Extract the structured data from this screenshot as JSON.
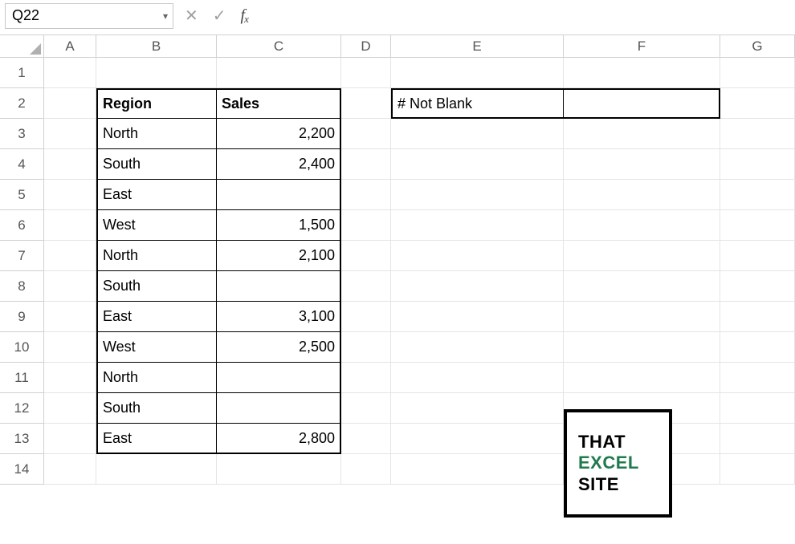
{
  "namebox": "Q22",
  "formula": "",
  "col_labels": [
    "A",
    "B",
    "C",
    "D",
    "E",
    "F",
    "G"
  ],
  "row_labels": [
    "1",
    "2",
    "3",
    "4",
    "5",
    "6",
    "7",
    "8",
    "9",
    "10",
    "11",
    "12",
    "13",
    "14"
  ],
  "table": {
    "header": {
      "region": "Region",
      "sales": "Sales"
    },
    "rows": [
      {
        "region": "North",
        "sales": "2,200"
      },
      {
        "region": "South",
        "sales": "2,400"
      },
      {
        "region": "East",
        "sales": ""
      },
      {
        "region": "West",
        "sales": "1,500"
      },
      {
        "region": "North",
        "sales": "2,100"
      },
      {
        "region": "South",
        "sales": ""
      },
      {
        "region": "East",
        "sales": "3,100"
      },
      {
        "region": "West",
        "sales": "2,500"
      },
      {
        "region": "North",
        "sales": ""
      },
      {
        "region": "South",
        "sales": ""
      },
      {
        "region": "East",
        "sales": "2,800"
      }
    ]
  },
  "summary": {
    "label": "# Not Blank",
    "value": ""
  },
  "logo": {
    "line1": "THAT",
    "line2": "EXCEL",
    "line3": "SITE"
  },
  "chart_data": {
    "type": "table",
    "categories": [
      "Region",
      "Sales"
    ],
    "rows": [
      [
        "North",
        2200
      ],
      [
        "South",
        2400
      ],
      [
        "East",
        null
      ],
      [
        "West",
        1500
      ],
      [
        "North",
        2100
      ],
      [
        "South",
        null
      ],
      [
        "East",
        3100
      ],
      [
        "West",
        2500
      ],
      [
        "North",
        null
      ],
      [
        "South",
        null
      ],
      [
        "East",
        2800
      ]
    ]
  }
}
